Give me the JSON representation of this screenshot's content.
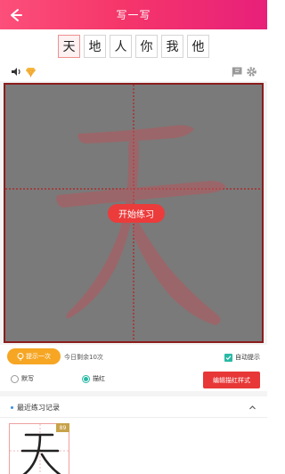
{
  "header": {
    "title": "写一写",
    "back_icon": "back-arrow-icon"
  },
  "chars": [
    "天",
    "地",
    "人",
    "你",
    "我",
    "他"
  ],
  "active_char": "天",
  "toolbar": {
    "left_icons": [
      "speaker-icon",
      "diamond-icon"
    ],
    "right_icons": [
      "flag-icon",
      "gear-icon"
    ]
  },
  "grid": {
    "character": "天",
    "start_label": "开始练习"
  },
  "controls": {
    "hint_label": "提示一次",
    "remaining": "今日剩余10次",
    "auto_hint_label": "自动提示",
    "auto_hint_checked": true,
    "modes": [
      {
        "label": "默写",
        "selected": false
      },
      {
        "label": "描红",
        "selected": true
      }
    ],
    "edit_label": "编辑描红样式"
  },
  "records": {
    "title": "最近练习记录",
    "items": [
      {
        "char": "天",
        "score": "89"
      }
    ]
  },
  "colors": {
    "header_start": "#fc4f7a",
    "header_end": "#e8207a",
    "grid_border": "#8b1d1d",
    "accent_red": "#e83737",
    "teal": "#28b9a5",
    "orange": "#f6a623"
  }
}
